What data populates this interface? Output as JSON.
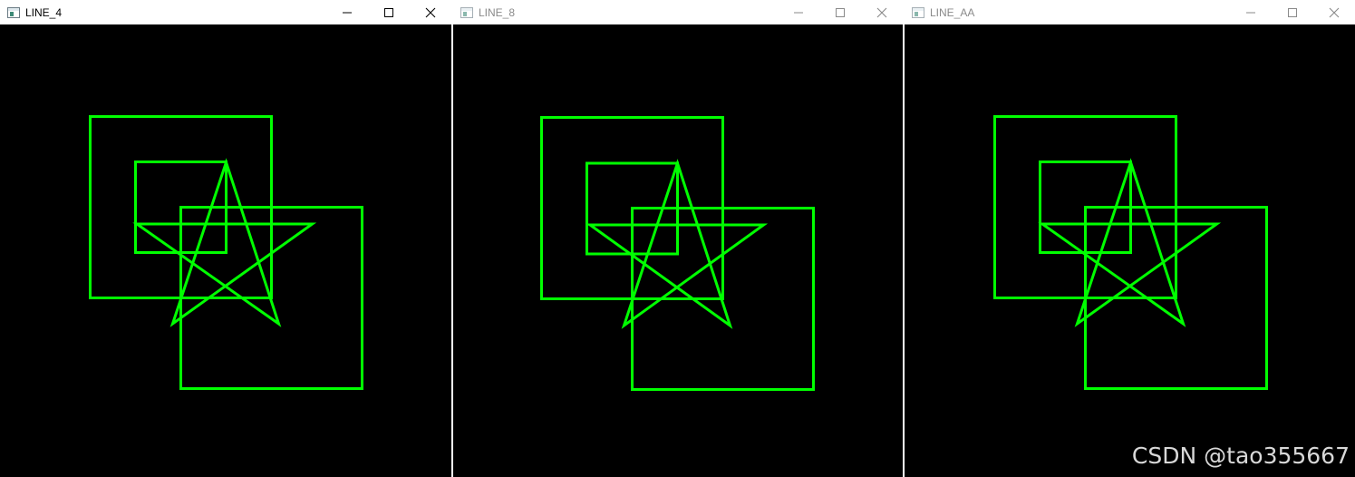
{
  "windows": [
    {
      "title": "LINE_4",
      "active": true
    },
    {
      "title": "LINE_8",
      "active": false
    },
    {
      "title": "LINE_AA",
      "active": false
    }
  ],
  "controls": {
    "minimize": "minimize-icon",
    "maximize": "maximize-icon",
    "close": "close-icon"
  },
  "colors": {
    "line": "#00ff00",
    "background": "#000000"
  },
  "watermark": "CSDN @tao355667"
}
